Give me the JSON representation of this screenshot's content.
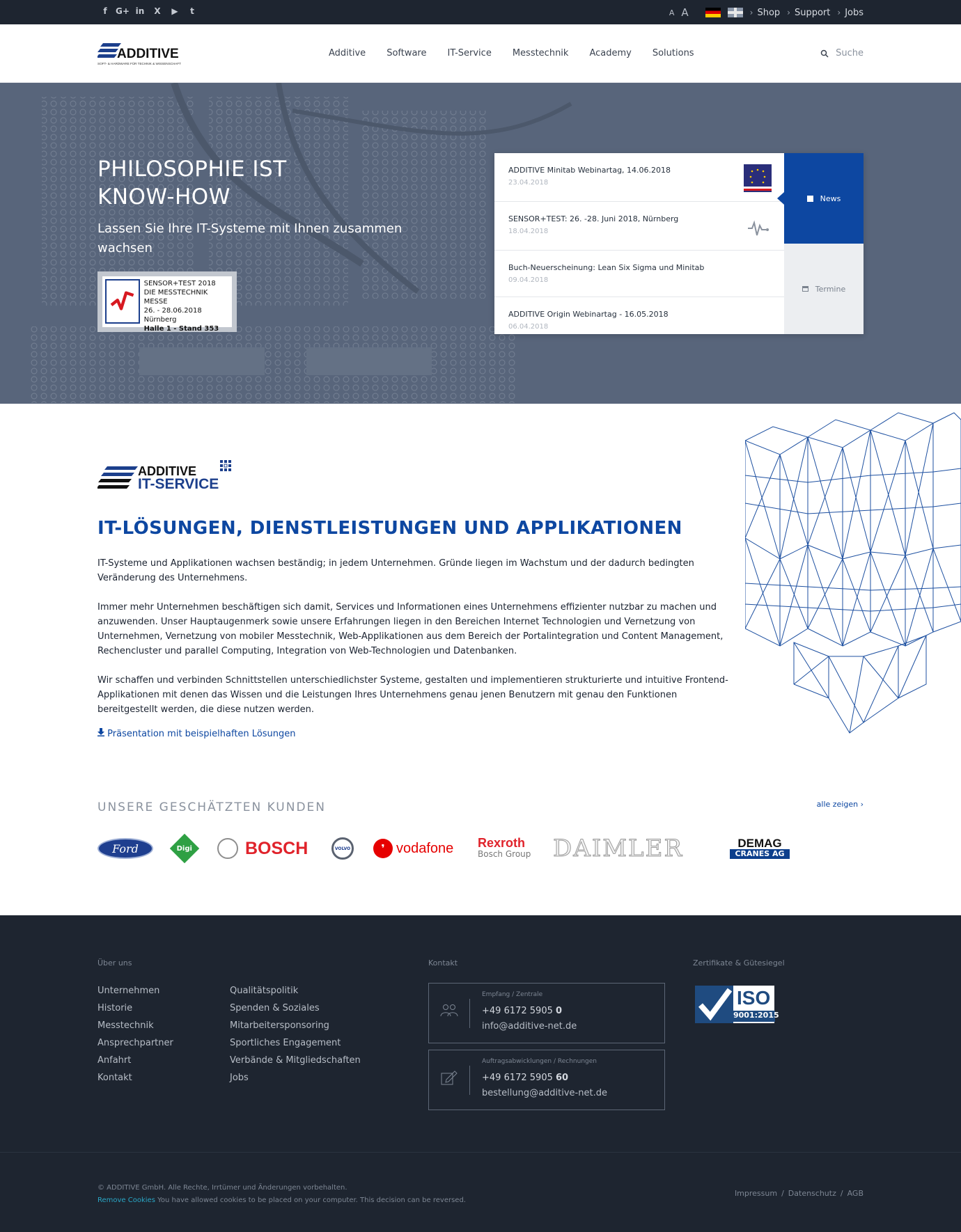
{
  "topbar": {
    "social": [
      {
        "icon": "facebook-icon",
        "glyph": "f"
      },
      {
        "icon": "google-plus-icon",
        "glyph": "G+"
      },
      {
        "icon": "linkedin-icon",
        "glyph": "in"
      },
      {
        "icon": "xing-icon",
        "glyph": "X"
      },
      {
        "icon": "youtube-icon",
        "glyph": "▶"
      },
      {
        "icon": "twitter-icon",
        "glyph": "t"
      }
    ],
    "font_small": "A",
    "font_large": "A",
    "links": [
      "Shop",
      "Support",
      "Jobs"
    ]
  },
  "header": {
    "logo_word": "ADDITIVE",
    "logo_tagline": "SOFT- & HARDWARE FÜR TECHNIK & WISSENSCHAFT",
    "nav": [
      "Additive",
      "Software",
      "IT-Service",
      "Messtechnik",
      "Academy",
      "Solutions"
    ],
    "search_label": "Suche"
  },
  "hero": {
    "title_line1": "PHILOSOPHIE IST",
    "title_line2": "KNOW-HOW",
    "subtitle": "Lassen Sie Ihre IT-Systeme mit Ihnen zusammen wachsen",
    "event": {
      "line1": "SENSOR+TEST 2018",
      "line2": "DIE MESSTECHNIK MESSE",
      "line3": "26. - 28.06.2018",
      "line4": "Nürnberg",
      "line5": "Halle 1 - Stand 353"
    },
    "news": [
      {
        "title": "ADDITIVE Minitab Webinartag, 14.06.2018",
        "date": "23.04.2018",
        "thumb": "eu-flag-thumbnail"
      },
      {
        "title": "SENSOR+TEST: 26. -28. Juni 2018, Nürnberg",
        "date": "18.04.2018",
        "thumb": "waveform-thumbnail"
      },
      {
        "title": "Buch-Neuerscheinung: Lean Six Sigma und Minitab",
        "date": "09.04.2018"
      },
      {
        "title": "ADDITIVE Origin Webinartag - 16.05.2018",
        "date": "06.04.2018"
      }
    ],
    "tab_news": "News",
    "tab_termine": "Termine"
  },
  "main": {
    "it_logo_word1": "ADDITIVE",
    "it_logo_word2": "IT-SERVICE",
    "heading": "IT-LÖSUNGEN, DIENSTLEISTUNGEN UND APPLIKATIONEN",
    "p1": "IT-Systeme und Applikationen wachsen beständig; in jedem Unternehmen. Gründe liegen im Wachstum und der dadurch bedingten Veränderung des Unternehmens.",
    "p2": "Immer mehr Unternehmen beschäftigen sich damit, Services und Informationen eines Unternehmens effizienter nutzbar zu machen und anzuwenden. Unser Hauptaugenmerk sowie unsere Erfahrungen liegen in den Bereichen Internet Technologien und Vernetzung von Unternehmen, Vernetzung von mobiler Messtechnik, Web-Applikationen aus dem Bereich der Portalintegration und Content Management, Rechencluster und parallel Computing, Integration von Web-Technologien und Datenbanken.",
    "p3": "Wir schaffen und verbinden Schnittstellen unterschiedlichster Systeme, gestalten und implementieren strukturierte und intuitive Frontend-Applikationen mit denen das Wissen und die Leistungen Ihres Unternehmens genau jenen Benutzern mit genau den Funktionen bereitgestellt werden, die diese nutzen werden.",
    "download_link": "Präsentation mit beispielhaften Lösungen"
  },
  "clients": {
    "heading": "UNSERE GESCHÄTZTEN KUNDEN",
    "show_all": "alle zeigen",
    "logos": {
      "ford": "Ford",
      "digi": "Digi",
      "bosch": "BOSCH",
      "volvo": "VOLVO",
      "vodafone": "vodafone",
      "rexroth": "Rexroth",
      "rexroth_sub": "Bosch Group",
      "daimler": "DAIMLER",
      "demag": "DEMAG",
      "demag_sub": "CRANES AG"
    }
  },
  "footer": {
    "about_heading": "Über uns",
    "about_col1": [
      "Unternehmen",
      "Historie",
      "Messtechnik",
      "Ansprechpartner",
      "Anfahrt",
      "Kontakt"
    ],
    "about_col2": [
      "Qualitätspolitik",
      "Spenden & Soziales",
      "Mitarbeitersponsoring",
      "Sportliches Engagement",
      "Verbände & Mitgliedschaften",
      "Jobs"
    ],
    "contact_heading": "Kontakt",
    "contact1": {
      "label": "Empfang / Zentrale",
      "phone": "+49 6172 5905 ",
      "phone_ext": "0",
      "email": "info@additive-net.de"
    },
    "contact2": {
      "label": "Auftragsabwicklungen / Rechnungen",
      "phone": "+49 6172 5905 ",
      "phone_ext": "60",
      "email": "bestellung@additive-net.de"
    },
    "cert_heading": "Zertifikate & Gütesiegel",
    "iso_title": "ISO",
    "iso_sub": "9001:2015"
  },
  "bottom": {
    "copyright": "© ADDITIVE GmbH. Alle Rechte, Irrtümer und Änderungen vorbehalten.",
    "remove_cookies": "Remove Cookies",
    "cookie_text": " You have allowed cookies to be placed on your computer. This decision can be reversed.",
    "legal": [
      "Impressum",
      "Datenschutz",
      "AGB"
    ]
  },
  "colors": {
    "brand_blue": "#0d47a1",
    "dark_bg": "#1e2530",
    "hero_bg": "#5d6a7e"
  }
}
